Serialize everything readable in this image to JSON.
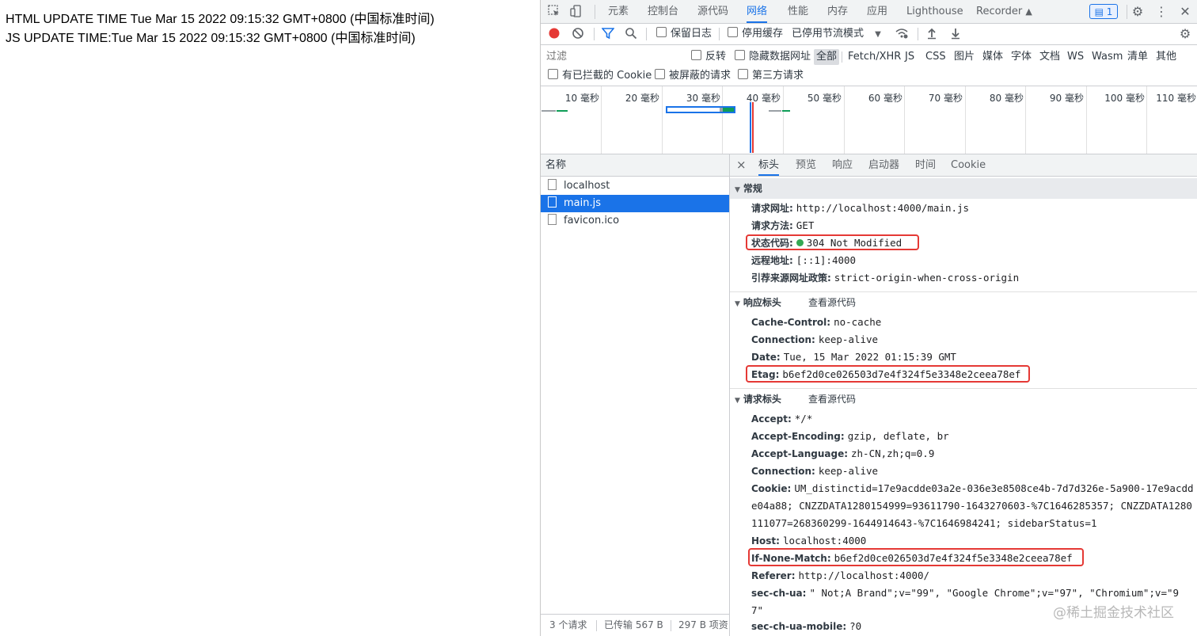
{
  "page": {
    "line1": "HTML UPDATE TIME Tue Mar 15 2022 09:15:32 GMT+0800 (中国标准时间)",
    "line2": "JS UPDATE TIME:Tue Mar 15 2022 09:15:32 GMT+0800 (中国标准时间)"
  },
  "devtools": {
    "panel_tabs": [
      "元素",
      "控制台",
      "源代码",
      "网络",
      "性能",
      "内存",
      "应用",
      "Lighthouse",
      "Recorder"
    ],
    "active_panel": "网络",
    "issues_badge": "1",
    "toolbar": {
      "preserve_log": "保留日志",
      "disable_cache": "停用缓存",
      "throttling": "已停用节流模式"
    },
    "filter": {
      "placeholder": "过滤",
      "invert": "反转",
      "hide_data_urls": "隐藏数据网址",
      "types": [
        "全部",
        "Fetch/XHR",
        "JS",
        "CSS",
        "图片",
        "媒体",
        "字体",
        "文档",
        "WS",
        "Wasm",
        "清单",
        "其他"
      ],
      "active_type": "全部",
      "blocked_cookies": "有已拦截的 Cookie",
      "blocked_requests": "被屏蔽的请求",
      "third_party": "第三方请求"
    },
    "timeline_ticks": [
      "10 毫秒",
      "20 毫秒",
      "30 毫秒",
      "40 毫秒",
      "50 毫秒",
      "60 毫秒",
      "70 毫秒",
      "80 毫秒",
      "90 毫秒",
      "100 毫秒",
      "110 毫秒"
    ],
    "request_list": {
      "header": "名称",
      "rows": [
        "localhost",
        "main.js",
        "favicon.ico"
      ],
      "selected": "main.js",
      "footer": {
        "requests": "3 个请求",
        "transferred": "已传输 567 B",
        "resources": "297 B 项资"
      }
    },
    "details": {
      "close": "×",
      "tabs": [
        "标头",
        "预览",
        "响应",
        "启动器",
        "时间",
        "Cookie"
      ],
      "active_tab": "标头",
      "general": {
        "title": "常规",
        "rows": [
          {
            "key": "请求网址:",
            "value": "http://localhost:4000/main.js"
          },
          {
            "key": "请求方法:",
            "value": "GET"
          },
          {
            "key": "状态代码:",
            "value": "304 Not Modified"
          },
          {
            "key": "远程地址:",
            "value": "[::1]:4000"
          },
          {
            "key": "引荐来源网址政策:",
            "value": "strict-origin-when-cross-origin"
          }
        ]
      },
      "response_headers": {
        "title": "响应标头",
        "view_source": "查看源代码",
        "rows": [
          {
            "key": "Cache-Control:",
            "value": "no-cache"
          },
          {
            "key": "Connection:",
            "value": "keep-alive"
          },
          {
            "key": "Date:",
            "value": "Tue, 15 Mar 2022 01:15:39 GMT"
          },
          {
            "key": "Etag:",
            "value": "b6ef2d0ce026503d7e4f324f5e3348e2ceea78ef"
          }
        ]
      },
      "request_headers": {
        "title": "请求标头",
        "view_source": "查看源代码",
        "accept": {
          "key": "Accept:",
          "value": "*/*"
        },
        "accept_encoding": {
          "key": "Accept-Encoding:",
          "value": "gzip, deflate, br"
        },
        "accept_language": {
          "key": "Accept-Language:",
          "value": "zh-CN,zh;q=0.9"
        },
        "connection": {
          "key": "Connection:",
          "value": "keep-alive"
        },
        "cookie": {
          "key": "Cookie:",
          "line1": "UM_distinctid=17e9acdde03a2e-036e3e8508ce4b-7d7d326e-5a900-17e9acdd",
          "line2": "e04a88; CNZZDATA1280154999=93611790-1643270603-%7C1646285357; CNZZDATA1280",
          "line3": "111077=268360299-1644914643-%7C1646984241; sidebarStatus=1"
        },
        "host": {
          "key": "Host:",
          "value": "localhost:4000"
        },
        "if_none_match": {
          "key": "If-None-Match:",
          "value": "b6ef2d0ce026503d7e4f324f5e3348e2ceea78ef"
        },
        "referer": {
          "key": "Referer:",
          "value": "http://localhost:4000/"
        },
        "sec_ch_ua": {
          "key": "sec-ch-ua:",
          "line1": "\" Not;A Brand\";v=\"99\", \"Google Chrome\";v=\"97\", \"Chromium\";v=\"9",
          "line2": "7\""
        },
        "sec_ch_ua_mobile": {
          "key": "sec-ch-ua-mobile:",
          "value": "?0"
        }
      }
    }
  },
  "watermark": "@稀土掘金技术社区",
  "colors": {
    "accent": "#1a73e8",
    "highlight": "#e53935",
    "status_ok": "#34a853"
  }
}
